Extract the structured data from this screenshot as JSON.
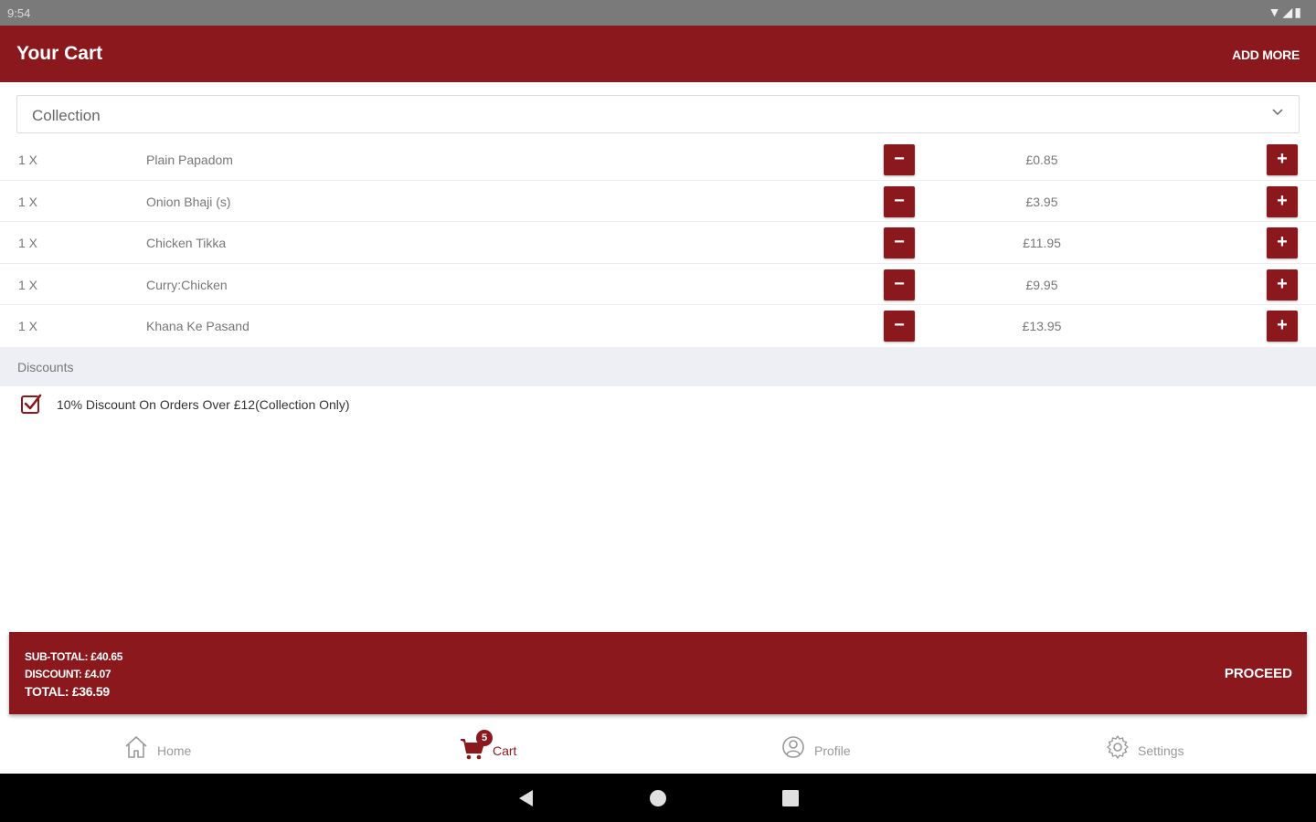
{
  "status_bar": {
    "time": "9:54",
    "icons": "▼◢▮"
  },
  "header": {
    "title": "Your Cart",
    "add_more": "ADD MORE"
  },
  "order_type": {
    "selected": "Collection"
  },
  "cart_items": [
    {
      "qty": "1 X",
      "name": "Plain Papadom",
      "price": "£0.85"
    },
    {
      "qty": "1 X",
      "name": "Onion Bhaji (s)",
      "price": "£3.95"
    },
    {
      "qty": "1 X",
      "name": "Chicken Tikka",
      "price": "£11.95"
    },
    {
      "qty": "1 X",
      "name": "Curry:Chicken",
      "price": "£9.95"
    },
    {
      "qty": "1 X",
      "name": "Khana Ke Pasand",
      "price": "£13.95"
    }
  ],
  "buttons": {
    "minus": "−",
    "plus": "+"
  },
  "discounts": {
    "header": "Discounts",
    "items": [
      {
        "label": "10% Discount On Orders Over £12(Collection Only)",
        "checked": true
      }
    ]
  },
  "summary": {
    "subtotal": "SUB-TOTAL: £40.65",
    "discount": "DISCOUNT: £4.07",
    "total": "TOTAL: £36.59",
    "proceed": "PROCEED"
  },
  "bottom_nav": {
    "home": "Home",
    "cart": "Cart",
    "cart_badge": "5",
    "profile": "Profile",
    "settings": "Settings"
  },
  "colors": {
    "brand": "#8b181d",
    "status_bar": "#7a7a7a",
    "discount_header_bg": "#eeeff4"
  }
}
